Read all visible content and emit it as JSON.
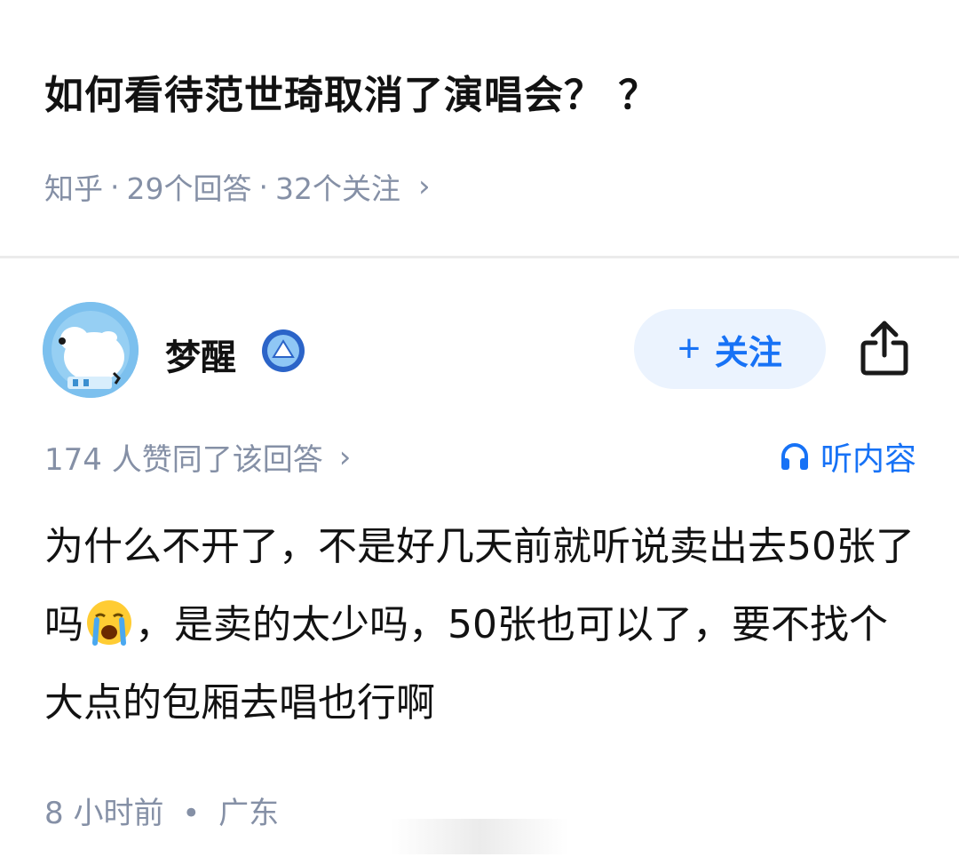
{
  "question": {
    "title": "如何看待范世琦取消了演唱会？ ？",
    "source": "知乎",
    "answers": "29个回答",
    "followers": "32个关注",
    "separator": "·",
    "chevron": "›"
  },
  "author": {
    "name": "梦醒",
    "follow_plus": "+",
    "follow_label": "关注"
  },
  "answer": {
    "votes": "174 人赞同了该回答",
    "votes_chevron": "›",
    "listen_label": "听内容",
    "content_part1": "为什么不开了，不是好几天前就听说卖出去50张了吗",
    "content_part2": "，是卖的太少吗，50张也可以了，要不找个大点的包厢去唱也行啊",
    "time": "8 小时前",
    "separator": "•",
    "location": "广东"
  },
  "icons": {
    "badge": "blue-level-badge-icon",
    "share": "share-icon",
    "listen": "headphones-icon",
    "emoji": "crying-face-emoji"
  },
  "colors": {
    "accent": "#1772f6",
    "follow_bg": "#ebf3fe",
    "meta_gray": "#8590a6",
    "text": "#121212"
  }
}
